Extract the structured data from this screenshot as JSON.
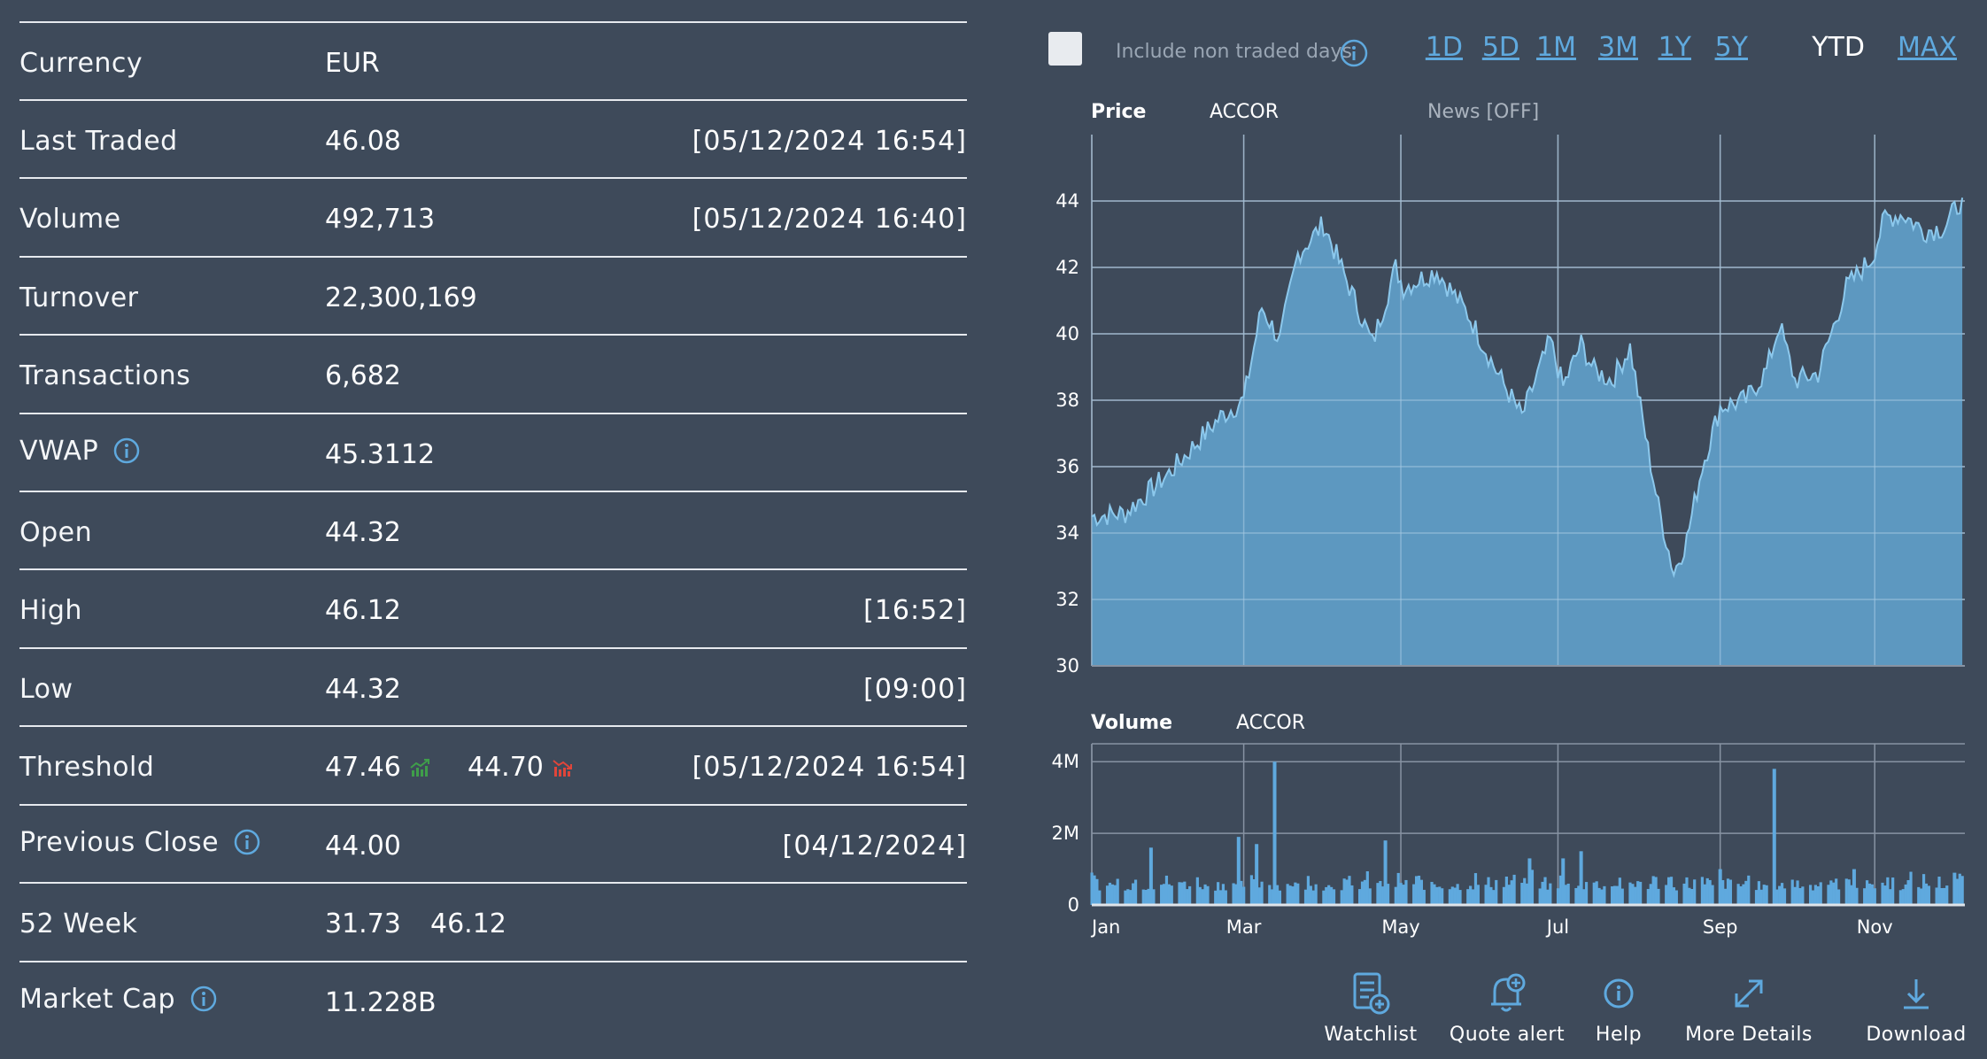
{
  "quote": {
    "rows": [
      {
        "label": "Currency",
        "value": "EUR",
        "time": ""
      },
      {
        "label": "Last Traded",
        "value": "46.08",
        "time": "[05/12/2024 16:54]"
      },
      {
        "label": "Volume",
        "value": "492,713",
        "time": "[05/12/2024 16:40]"
      },
      {
        "label": "Turnover",
        "value": "22,300,169",
        "time": ""
      },
      {
        "label": "Transactions",
        "value": "6,682",
        "time": ""
      },
      {
        "label": "VWAP",
        "value": "45.3112",
        "time": ""
      },
      {
        "label": "Open",
        "value": "44.32",
        "time": ""
      },
      {
        "label": "High",
        "value": "46.12",
        "time": "[16:52]"
      },
      {
        "label": "Low",
        "value": "44.32",
        "time": "[09:00]"
      },
      {
        "label": "Threshold",
        "value": "47.46",
        "value_low": "44.70",
        "time": "[05/12/2024 16:54]"
      },
      {
        "label": "Previous Close",
        "value": "44.00",
        "time": "[04/12/2024]"
      },
      {
        "label": "52 Week",
        "value": "31.73",
        "value_high": "46.12",
        "time": ""
      },
      {
        "label": "Market Cap",
        "value": "11.228B",
        "time": ""
      }
    ]
  },
  "controls": {
    "include_non_traded_label": "Include non traded days",
    "include_non_traded_checked": false,
    "ranges": [
      "1D",
      "5D",
      "1M",
      "3M",
      "1Y",
      "5Y",
      "YTD",
      "MAX"
    ],
    "active_range": "YTD"
  },
  "price_panel": {
    "title": "Price",
    "instrument": "ACCOR",
    "news": "News [OFF]"
  },
  "volume_panel": {
    "title": "Volume",
    "instrument": "ACCOR"
  },
  "toolbar": {
    "watchlist": "Watchlist",
    "quote_alert": "Quote alert",
    "help": "Help",
    "more_details": "More Details",
    "download": "Download"
  },
  "colors": {
    "area": "#5f9cc6",
    "line": "#8cc8ec",
    "accent": "#5fa9de",
    "up": "#3f9e4a",
    "down": "#e0453a"
  },
  "chart_data": [
    {
      "type": "area",
      "title": "Price",
      "series": [
        {
          "name": "ACCOR"
        }
      ],
      "ylim": [
        30,
        46
      ],
      "yticks": [
        30,
        32,
        34,
        36,
        38,
        40,
        42,
        44
      ],
      "xticks": [
        "Jan",
        "Mar",
        "May",
        "Jul",
        "Sep",
        "Nov"
      ],
      "x": [
        "2024-01-02",
        "2024-01-15",
        "2024-02-01",
        "2024-02-15",
        "2024-02-21",
        "2024-03-01",
        "2024-03-08",
        "2024-03-15",
        "2024-03-22",
        "2024-04-01",
        "2024-04-10",
        "2024-04-20",
        "2024-04-29",
        "2024-05-02",
        "2024-05-15",
        "2024-05-27",
        "2024-06-07",
        "2024-06-17",
        "2024-06-28",
        "2024-07-03",
        "2024-07-10",
        "2024-07-15",
        "2024-07-22",
        "2024-07-29",
        "2024-08-02",
        "2024-08-05",
        "2024-08-09",
        "2024-08-15",
        "2024-08-20",
        "2024-08-26",
        "2024-09-02",
        "2024-09-12",
        "2024-09-20",
        "2024-09-25",
        "2024-10-01",
        "2024-10-10",
        "2024-10-21",
        "2024-10-31",
        "2024-11-05",
        "2024-11-12",
        "2024-11-20",
        "2024-11-28",
        "2024-12-05"
      ],
      "y": [
        34.5,
        34.6,
        35.8,
        37.0,
        37.5,
        38.0,
        40.8,
        39.8,
        42.4,
        43.3,
        41.6,
        39.7,
        42.0,
        41.4,
        41.9,
        40.6,
        38.9,
        37.5,
        39.8,
        38.4,
        39.7,
        38.9,
        38.6,
        39.6,
        37.8,
        36.5,
        34.8,
        32.8,
        33.8,
        36.0,
        37.8,
        38.0,
        38.9,
        40.3,
        38.6,
        38.8,
        41.4,
        42.3,
        43.5,
        43.6,
        43.1,
        43.2,
        44.1
      ]
    },
    {
      "type": "bar",
      "title": "Volume",
      "series": [
        {
          "name": "ACCOR"
        }
      ],
      "ylim": [
        0,
        4500000
      ],
      "yticks": [
        "0",
        "2M",
        "4M"
      ],
      "xticks": [
        "Jan",
        "Mar",
        "May",
        "Jul",
        "Sep",
        "Nov"
      ],
      "x": [
        "2024-01-25",
        "2024-02-28",
        "2024-03-06",
        "2024-03-13",
        "2024-04-25",
        "2024-06-20",
        "2024-07-03",
        "2024-07-10",
        "2024-09-02",
        "2024-09-23",
        "2024-10-24",
        "2024-12-02"
      ],
      "values": [
        1600000,
        1900000,
        1700000,
        4000000,
        1800000,
        1300000,
        1300000,
        1500000,
        1000000,
        3800000,
        1000000,
        900000
      ],
      "typical_daily": [
        400000,
        800000
      ]
    }
  ]
}
